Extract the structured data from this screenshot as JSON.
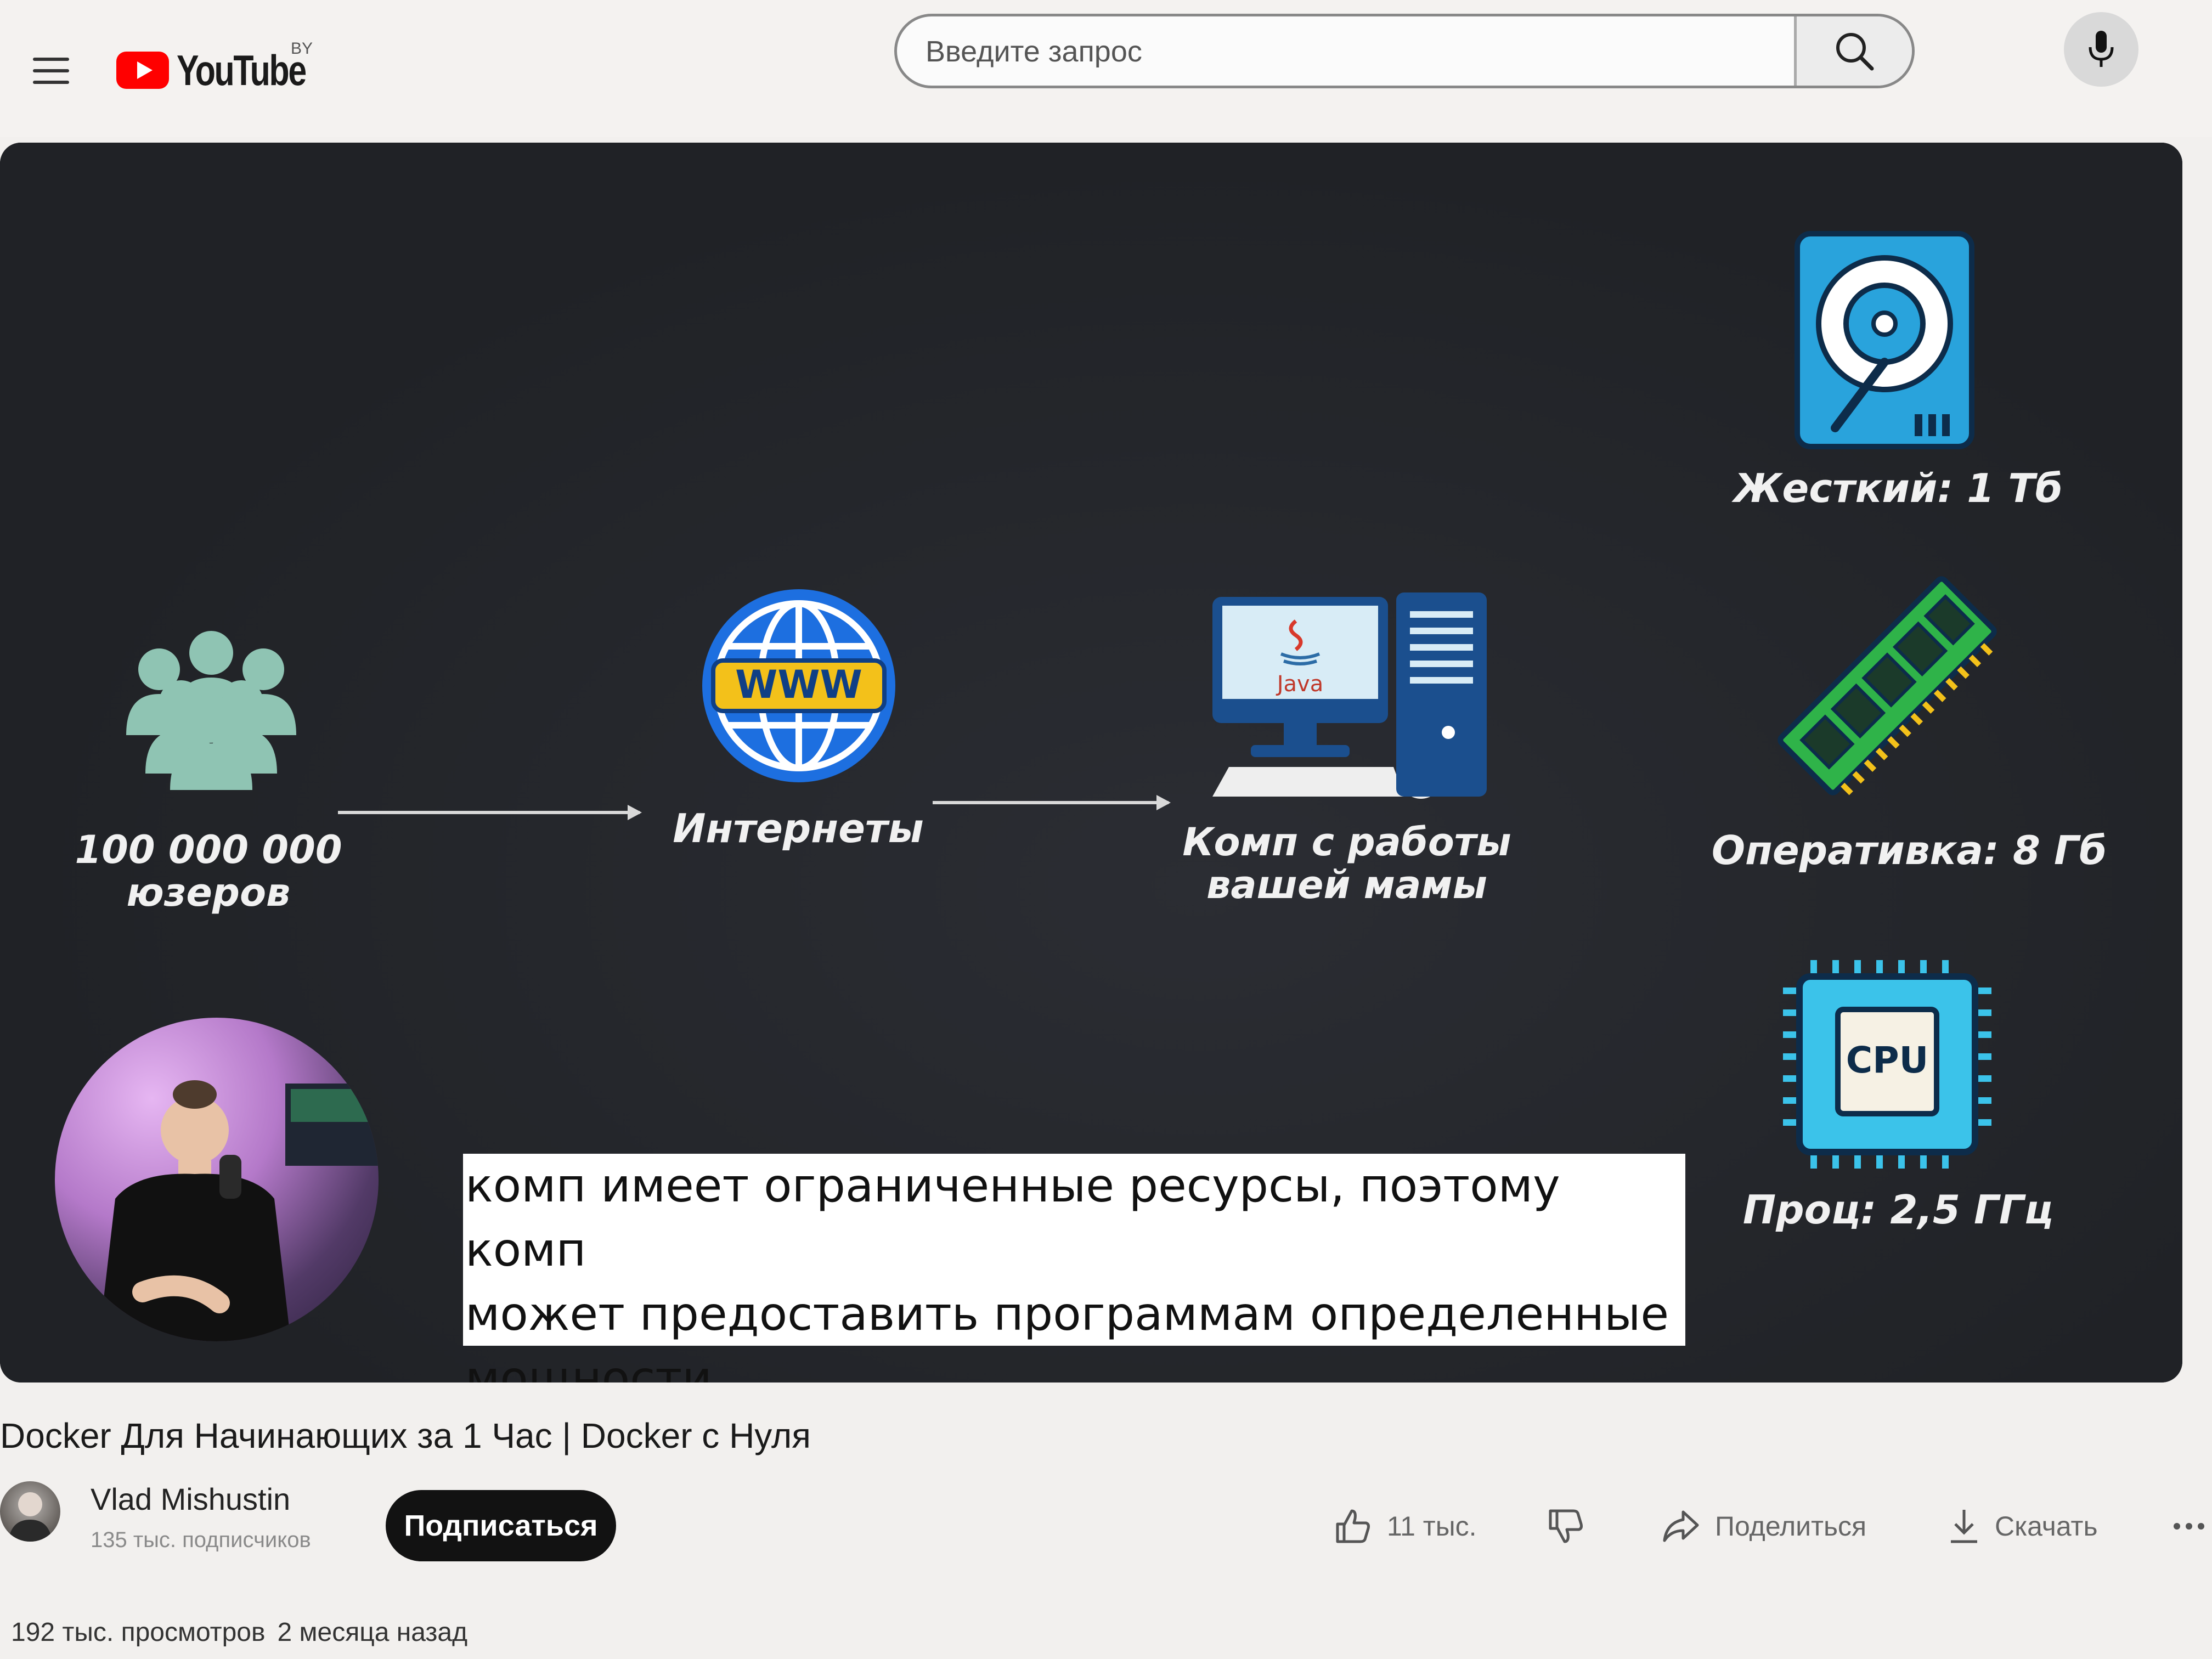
{
  "header": {
    "logo_text": "YouTube",
    "country_code": "BY",
    "search_placeholder": "Введите запрос"
  },
  "video": {
    "diagram": {
      "users_label": "100 000 000\nюзеров",
      "internet_label": "Интернеты",
      "internet_icon_text": "WWW",
      "computer_label": "Комп с работы\nвашей мамы",
      "computer_screen_text": "Java",
      "hdd_label": "Жесткий: 1 Тб",
      "ram_label": "Оперативка: 8 Гб",
      "cpu_label": "Проц: 2,5 ГГц",
      "cpu_chip_text": "CPU"
    },
    "subtitle": "комп имеет ограниченные ресурсы, поэтому комп\nможет предоставить программам определенные\nмощности"
  },
  "meta": {
    "title": "Docker Для Начинающих за 1 Час | Docker с Нуля",
    "channel_name": "Vlad Mishustin",
    "subscribers": "135 тыс. подписчиков",
    "subscribe_label": "Подписаться",
    "likes": "11 тыс.",
    "share_label": "Поделиться",
    "download_label": "Скачать",
    "views": "192 тыс. просмотров",
    "published": "2 месяца назад"
  },
  "colors": {
    "youtube_red": "#ff0000",
    "video_bg": "#23252a",
    "users_icon": "#8fc4b3",
    "globe_blue": "#1d6fe0",
    "globe_band": "#f3c11a",
    "hdd_blue": "#29a3dc",
    "ram_green": "#2fb349",
    "cpu_cyan": "#3bc3ea"
  },
  "icons": [
    "menu-icon",
    "youtube-logo-icon",
    "search-icon",
    "microphone-icon",
    "users-icon",
    "globe-www-icon",
    "computer-icon",
    "hard-drive-icon",
    "ram-icon",
    "cpu-icon",
    "like-icon",
    "dislike-icon",
    "share-icon",
    "download-icon",
    "more-icon"
  ]
}
